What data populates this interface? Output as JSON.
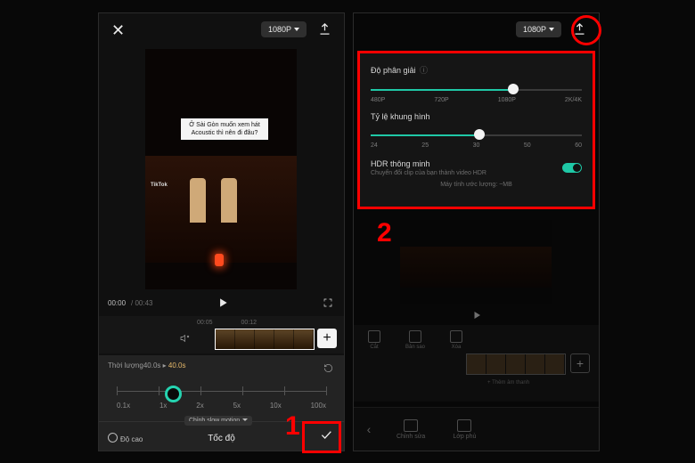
{
  "left": {
    "resolution_button": "1080P",
    "preview": {
      "caption": "Ở Sài Gòn muốn xem hát Acoustic thì nên đi đâu?",
      "watermark": "TikTok"
    },
    "transport": {
      "current": "00:00",
      "duration": "00:43"
    },
    "timeline": {
      "ticks": [
        "00:05",
        "00:12"
      ]
    },
    "speed": {
      "header_label": "Thời lượng",
      "header_orig": "40.0s",
      "header_arrow": "▸",
      "header_new": "40.0s",
      "marks": [
        "0.1x",
        "1x",
        "2x",
        "5x",
        "10x",
        "100x"
      ],
      "motion_chip": "Chỉnh slow motion",
      "pitch_label": "Độ cao",
      "title": "Tốc độ"
    }
  },
  "right": {
    "resolution_button": "1080P",
    "export": {
      "resolution_label": "Độ phân giải",
      "resolution_marks": [
        "480P",
        "720P",
        "1080P",
        "2K/4K"
      ],
      "framerate_label": "Tỷ lệ khung hình",
      "framerate_marks": [
        "24",
        "25",
        "30",
        "50",
        "60"
      ],
      "hdr_label": "HDR thông minh",
      "hdr_sub": "Chuyển đổi clip của bạn thành video HDR",
      "footer": "Máy tính ước lượng: ~MB"
    },
    "tools": [
      "Cắt",
      "Bản sao",
      "Xóa"
    ],
    "audio_hint": "+ Thêm âm thanh",
    "bottom_tabs": [
      "Chỉnh sửa",
      "Lớp phủ"
    ]
  },
  "annotations": {
    "n1": "1",
    "n2": "2"
  }
}
